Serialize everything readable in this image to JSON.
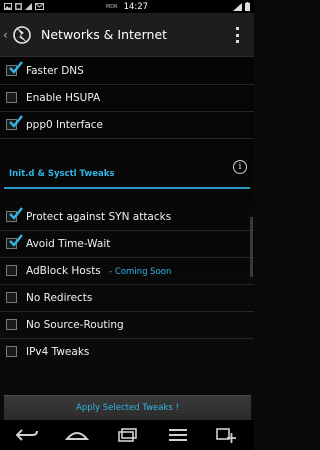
{
  "status_bar": {
    "carrier": "MDR",
    "time": "14:27",
    "left_icons": [
      "image-icon",
      "notification-icon",
      "signal-icon",
      "email-icon"
    ],
    "right_icons": [
      "signal-strength-icon",
      "battery-icon"
    ]
  },
  "action_bar": {
    "title": "Networks & Internet"
  },
  "network_options": [
    {
      "label": "Faster DNS",
      "checked": true
    },
    {
      "label": "Enable HSUPA",
      "checked": false
    },
    {
      "label": "ppp0 Interface",
      "checked": true
    }
  ],
  "section": {
    "title": "Init.d & Sysctl Tweaks",
    "info_glyph": "i"
  },
  "tweaks": [
    {
      "label": "Protect against SYN attacks",
      "checked": true
    },
    {
      "label": "Avoid Time-Wait",
      "checked": true
    },
    {
      "label": "AdBlock Hosts",
      "checked": false,
      "badge": "Coming Soon"
    },
    {
      "label": "No Redirects",
      "checked": false
    },
    {
      "label": "No Source-Routing",
      "checked": false
    },
    {
      "label": "IPv4 Tweaks",
      "checked": false
    }
  ],
  "apply_button": {
    "label": "Apply Selected Tweaks !"
  },
  "nav_bar": {
    "buttons": [
      "back-icon",
      "home-icon",
      "recent-apps-icon",
      "menu-icon",
      "screenshot-icon"
    ]
  },
  "colors": {
    "accent": "#33b5e5",
    "background": "#0a0a0a",
    "action_bar": "#1d1d1d"
  }
}
